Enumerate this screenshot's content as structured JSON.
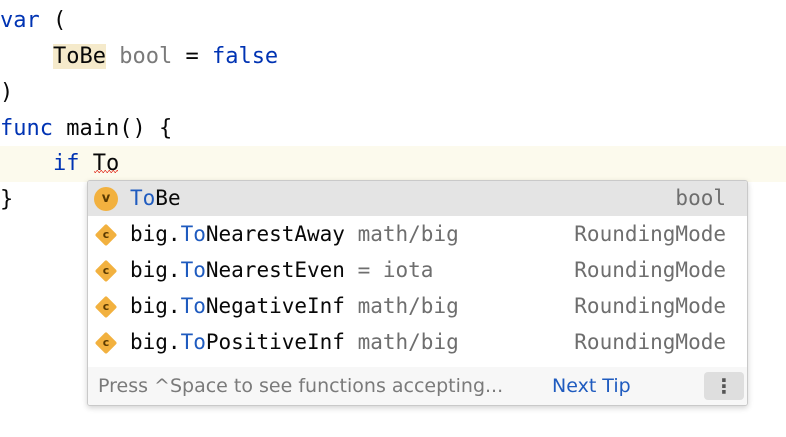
{
  "editor": {
    "lines": [
      {
        "kw": "var",
        "rest": " ("
      },
      {
        "indent": "    ",
        "ident": "ToBe",
        "type": "bool",
        "op": " = ",
        "value": "false"
      },
      {
        "text": ")"
      },
      {
        "kw": "func",
        "rest": " main() {"
      },
      {
        "indent": "    ",
        "kw": "if",
        "space": " ",
        "typed": "To"
      },
      {
        "text": "}"
      }
    ]
  },
  "completion": {
    "items": [
      {
        "icon": "variable-icon",
        "icon_letter": "v",
        "prefix": "",
        "match": "To",
        "rest": "Be",
        "tail": "",
        "type": "bool"
      },
      {
        "icon": "constant-icon",
        "icon_letter": "c",
        "prefix": "big.",
        "match": "To",
        "rest": "NearestAway",
        "tail": " math/big",
        "type": "RoundingMode"
      },
      {
        "icon": "constant-icon",
        "icon_letter": "c",
        "prefix": "big.",
        "match": "To",
        "rest": "NearestEven",
        "tail": " = iota",
        "type": "RoundingMode"
      },
      {
        "icon": "constant-icon",
        "icon_letter": "c",
        "prefix": "big.",
        "match": "To",
        "rest": "NegativeInf",
        "tail": " math/big",
        "type": "RoundingMode"
      },
      {
        "icon": "constant-icon",
        "icon_letter": "c",
        "prefix": "big.",
        "match": "To",
        "rest": "PositiveInf",
        "tail": " math/big",
        "type": "RoundingMode"
      }
    ],
    "footer": {
      "hint": "Press ^Space to see functions accepting...",
      "next_tip": "Next Tip",
      "more_icon": "vertical-ellipsis-icon",
      "more_glyph": "⋮"
    }
  },
  "colors": {
    "keyword": "#0033b3",
    "match_highlight": "#1f5bbf",
    "icon_fill": "#f2b13f",
    "selected_row": "#e4e4e4",
    "current_line": "#fcfaed"
  }
}
